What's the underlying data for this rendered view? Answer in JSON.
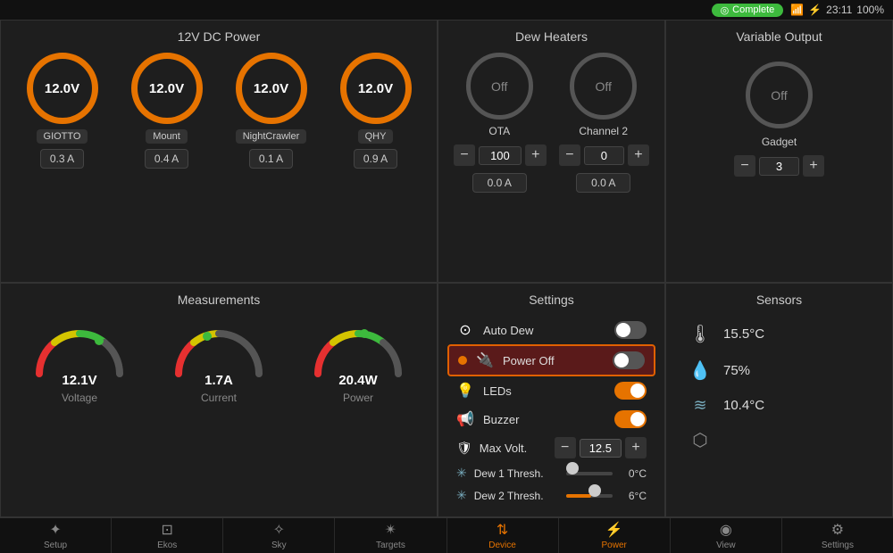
{
  "statusBar": {
    "complete": "Complete",
    "wifi": "wifi",
    "battery": "100%",
    "time": "23:11"
  },
  "dcPower": {
    "title": "12V DC Power",
    "gauges": [
      {
        "voltage": "12.0V",
        "device": "GIOTTO",
        "current": "0.3 A"
      },
      {
        "voltage": "12.0V",
        "device": "Mount",
        "current": "0.4 A"
      },
      {
        "voltage": "12.0V",
        "device": "NightCrawler",
        "current": "0.1 A"
      },
      {
        "voltage": "12.0V",
        "device": "QHY",
        "current": "0.9 A"
      }
    ]
  },
  "dewHeaters": {
    "title": "Dew Heaters",
    "channels": [
      {
        "label": "OTA",
        "state": "Off",
        "value": "100",
        "amps": "0.0 A"
      },
      {
        "label": "Channel 2",
        "state": "Off",
        "value": "0",
        "amps": "0.0 A"
      }
    ]
  },
  "variableOutput": {
    "title": "Variable Output",
    "channel": {
      "label": "Gadget",
      "state": "Off",
      "value": "3"
    }
  },
  "measurements": {
    "title": "Measurements",
    "items": [
      {
        "value": "12.1V",
        "label": "Voltage",
        "percent": 75
      },
      {
        "value": "1.7A",
        "label": "Current",
        "percent": 40
      },
      {
        "value": "20.4W",
        "label": "Power",
        "percent": 55
      }
    ]
  },
  "settings": {
    "title": "Settings",
    "rows": [
      {
        "icon": "⊙",
        "label": "Auto Dew",
        "type": "toggle",
        "state": "off"
      },
      {
        "icon": "🔌",
        "label": "Power Off",
        "type": "toggle",
        "state": "off",
        "highlighted": true
      },
      {
        "icon": "💡",
        "label": "LEDs",
        "type": "toggle",
        "state": "on"
      },
      {
        "icon": "📢",
        "label": "Buzzer",
        "type": "toggle",
        "state": "on"
      }
    ],
    "maxVolt": {
      "label": "Max Volt.",
      "value": "12.5"
    },
    "thresholds": [
      {
        "label": "Dew 1 Thresh.",
        "value": "0°C",
        "fillPct": 0
      },
      {
        "label": "Dew 2 Thresh.",
        "value": "6°C",
        "fillPct": 55
      }
    ]
  },
  "sensors": {
    "title": "Sensors",
    "items": [
      {
        "icon": "🌡",
        "value": "15.5°C"
      },
      {
        "icon": "💧",
        "value": "75%"
      },
      {
        "icon": "〜",
        "value": "10.4°C"
      },
      {
        "icon": "⬡",
        "value": ""
      }
    ]
  },
  "bottomNav": {
    "items": [
      {
        "icon": "✦",
        "label": "Setup"
      },
      {
        "icon": "⊡",
        "label": "Ekos"
      },
      {
        "icon": "✧",
        "label": "Sky"
      },
      {
        "icon": "✴",
        "label": "Targets"
      },
      {
        "icon": "⇅",
        "label": "Device",
        "active": true
      },
      {
        "icon": "⚡",
        "label": "Power",
        "active": true
      },
      {
        "icon": "◉",
        "label": "View"
      },
      {
        "icon": "⚙",
        "label": "Settings"
      }
    ]
  }
}
